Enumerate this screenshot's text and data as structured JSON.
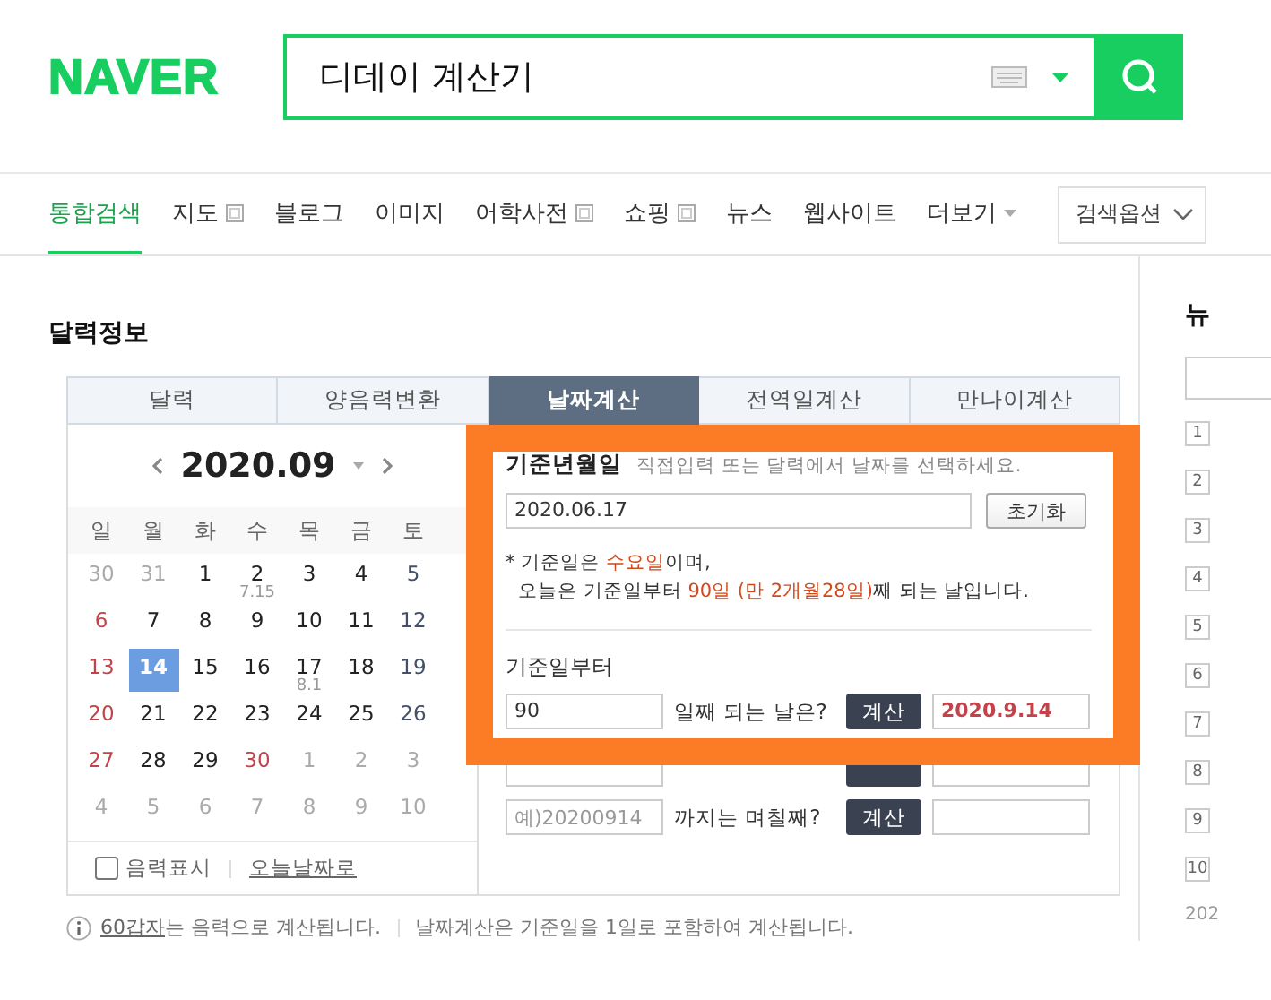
{
  "header": {
    "logo": "NAVER",
    "search": {
      "value": "디데이 계산기"
    }
  },
  "nav": {
    "tabs": [
      {
        "label": "통합검색",
        "selected": true,
        "kind": "plain"
      },
      {
        "label": "지도",
        "selected": false,
        "kind": "popup"
      },
      {
        "label": "블로그",
        "selected": false,
        "kind": "plain"
      },
      {
        "label": "이미지",
        "selected": false,
        "kind": "plain"
      },
      {
        "label": "어학사전",
        "selected": false,
        "kind": "popup"
      },
      {
        "label": "쇼핑",
        "selected": false,
        "kind": "popup"
      },
      {
        "label": "뉴스",
        "selected": false,
        "kind": "plain"
      },
      {
        "label": "웹사이트",
        "selected": false,
        "kind": "plain"
      },
      {
        "label": "더보기",
        "selected": false,
        "kind": "more"
      }
    ],
    "options": "검색옵션"
  },
  "section_title": "달력정보",
  "calendar_tabs": [
    {
      "label": "달력",
      "selected": false
    },
    {
      "label": "양음력변환",
      "selected": false
    },
    {
      "label": "날짜계산",
      "selected": true
    },
    {
      "label": "전역일계산",
      "selected": false
    },
    {
      "label": "만나이계산",
      "selected": false
    }
  ],
  "calendar": {
    "month": "2020.09",
    "weekdays": [
      "일",
      "월",
      "화",
      "수",
      "목",
      "금",
      "토"
    ],
    "weeks": [
      [
        {
          "day": "30",
          "kind": "muted",
          "selected": false
        },
        {
          "day": "31",
          "kind": "muted",
          "selected": false
        },
        {
          "day": "1",
          "kind": "plain",
          "selected": false
        },
        {
          "day": "2",
          "kind": "plain",
          "selected": false,
          "lunar": "7.15"
        },
        {
          "day": "3",
          "kind": "plain",
          "selected": false
        },
        {
          "day": "4",
          "kind": "plain",
          "selected": false
        },
        {
          "day": "5",
          "kind": "sat",
          "selected": false
        }
      ],
      [
        {
          "day": "6",
          "kind": "red",
          "selected": false
        },
        {
          "day": "7",
          "kind": "plain",
          "selected": false
        },
        {
          "day": "8",
          "kind": "plain",
          "selected": false
        },
        {
          "day": "9",
          "kind": "plain",
          "selected": false
        },
        {
          "day": "10",
          "kind": "plain",
          "selected": false
        },
        {
          "day": "11",
          "kind": "plain",
          "selected": false
        },
        {
          "day": "12",
          "kind": "sat",
          "selected": false
        }
      ],
      [
        {
          "day": "13",
          "kind": "red",
          "selected": false
        },
        {
          "day": "14",
          "kind": "plain",
          "selected": true
        },
        {
          "day": "15",
          "kind": "plain",
          "selected": false
        },
        {
          "day": "16",
          "kind": "plain",
          "selected": false
        },
        {
          "day": "17",
          "kind": "plain",
          "selected": false,
          "lunar": "8.1"
        },
        {
          "day": "18",
          "kind": "plain",
          "selected": false
        },
        {
          "day": "19",
          "kind": "sat",
          "selected": false
        }
      ],
      [
        {
          "day": "20",
          "kind": "red",
          "selected": false
        },
        {
          "day": "21",
          "kind": "plain",
          "selected": false
        },
        {
          "day": "22",
          "kind": "plain",
          "selected": false
        },
        {
          "day": "23",
          "kind": "plain",
          "selected": false
        },
        {
          "day": "24",
          "kind": "plain",
          "selected": false
        },
        {
          "day": "25",
          "kind": "plain",
          "selected": false
        },
        {
          "day": "26",
          "kind": "sat",
          "selected": false
        }
      ],
      [
        {
          "day": "27",
          "kind": "red",
          "selected": false
        },
        {
          "day": "28",
          "kind": "plain",
          "selected": false
        },
        {
          "day": "29",
          "kind": "plain",
          "selected": false
        },
        {
          "day": "30",
          "kind": "red",
          "selected": false
        },
        {
          "day": "1",
          "kind": "muted",
          "selected": false
        },
        {
          "day": "2",
          "kind": "muted",
          "selected": false
        },
        {
          "day": "3",
          "kind": "muted",
          "selected": false
        }
      ],
      [
        {
          "day": "4",
          "kind": "muted",
          "selected": false
        },
        {
          "day": "5",
          "kind": "muted",
          "selected": false
        },
        {
          "day": "6",
          "kind": "muted",
          "selected": false
        },
        {
          "day": "7",
          "kind": "muted",
          "selected": false
        },
        {
          "day": "8",
          "kind": "muted",
          "selected": false
        },
        {
          "day": "9",
          "kind": "muted",
          "selected": false
        },
        {
          "day": "10",
          "kind": "muted",
          "selected": false
        }
      ]
    ],
    "lunar_toggle": {
      "label": "음력표시",
      "checked": false
    },
    "today_link": "오늘날짜로"
  },
  "calculator": {
    "base_label": "기준년월일",
    "hint": "직접입력 또는 달력에서 날짜를 선택하세요.",
    "base_date": "2020.06.17",
    "reset_button": "초기화",
    "notes": [
      [
        {
          "text": "* 기준일은 ",
          "highlight": false
        },
        {
          "text": "수요일",
          "highlight": true
        },
        {
          "text": "이며,",
          "highlight": false
        }
      ],
      [
        {
          "text": "오늘은 기준일부터 ",
          "highlight": false
        },
        {
          "text": "90일 (만 2개월28일)",
          "highlight": true
        },
        {
          "text": "째 되는 날입니다.",
          "highlight": false
        }
      ]
    ],
    "from_label": "기준일부터",
    "covered_row": true,
    "rows": [
      {
        "input_value": "90",
        "question": "일째 되는 날은?",
        "button": "계산",
        "result": "2020.9.14"
      },
      {
        "placeholder": "예)20200914",
        "question": "까지는 며칠째?",
        "button": "계산"
      }
    ]
  },
  "footnotes": {
    "link": "60갑자",
    "first": "는 음력으로 계산됩니다.",
    "second": "날짜계산은 기준일을 1일로 포함하여 계산됩니다."
  },
  "sidebar": {
    "title": "뉴",
    "numbers": [
      "1",
      "2",
      "3",
      "4",
      "5",
      "6",
      "7",
      "8",
      "9",
      "10"
    ],
    "date": "202"
  }
}
